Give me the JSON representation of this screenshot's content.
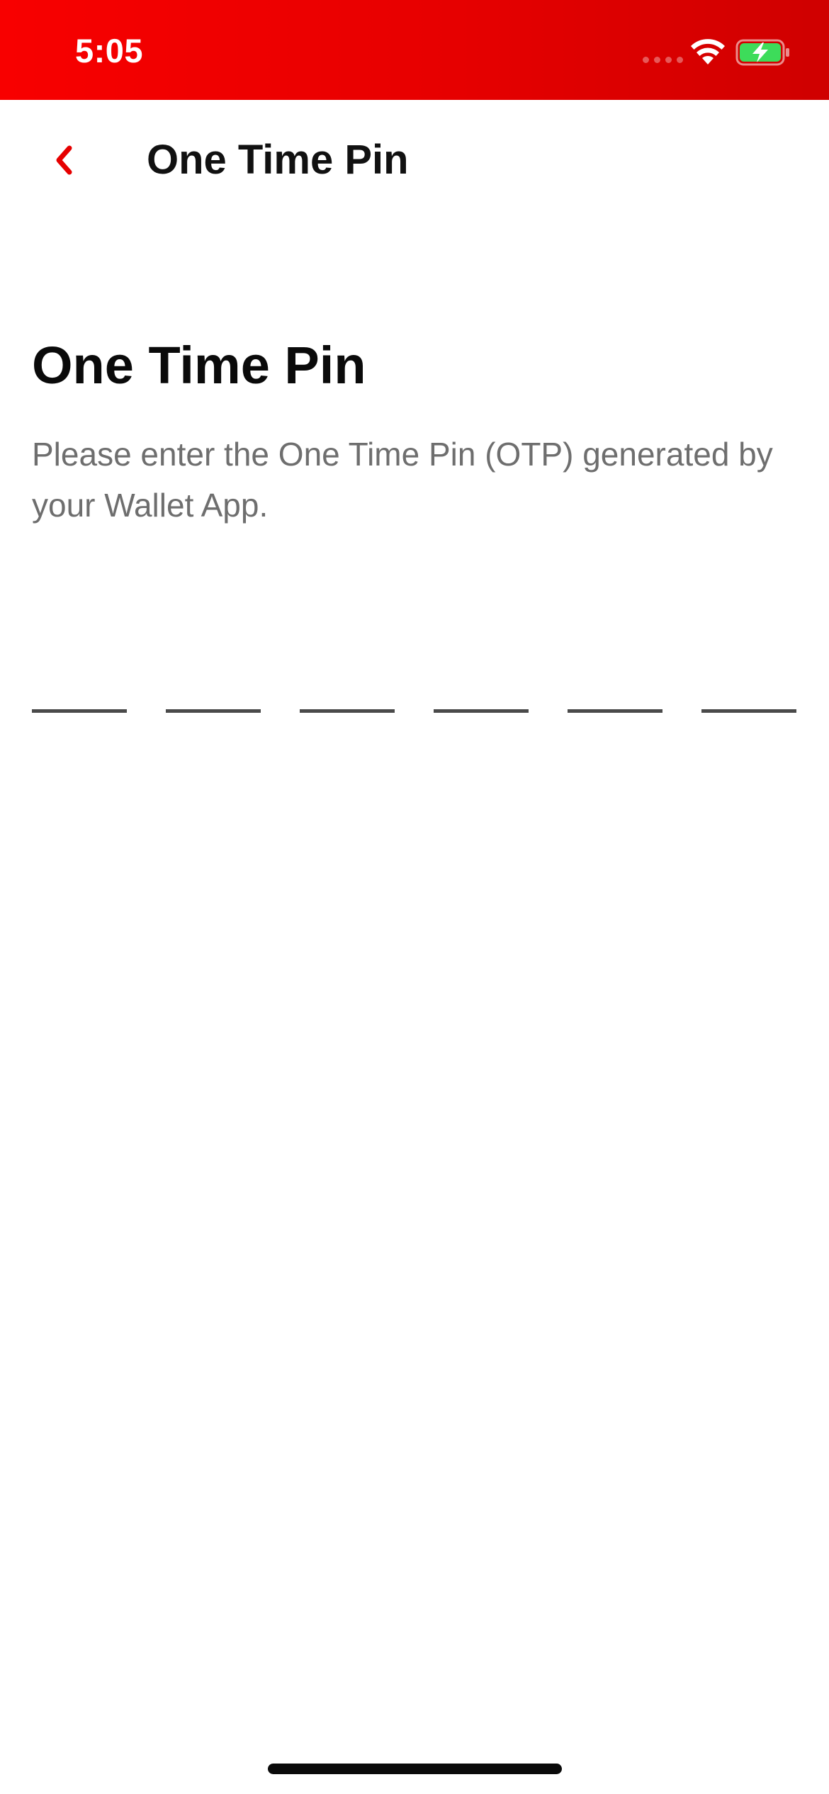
{
  "status_bar": {
    "time": "5:05",
    "background_colors": [
      "#f80000",
      "#cf0000"
    ],
    "icons": [
      "signal-icon",
      "wifi-icon",
      "battery-charging-icon"
    ],
    "battery_color": "#3ddc5a"
  },
  "nav": {
    "back_icon": "chevron-left-icon",
    "back_color": "#e60000",
    "title": "One Time Pin"
  },
  "content": {
    "heading": "One Time Pin",
    "description": "Please enter the One Time Pin (OTP) generated by your Wallet App."
  },
  "otp": {
    "digit_count": 6,
    "digits": [
      "",
      "",
      "",
      "",
      "",
      ""
    ]
  }
}
